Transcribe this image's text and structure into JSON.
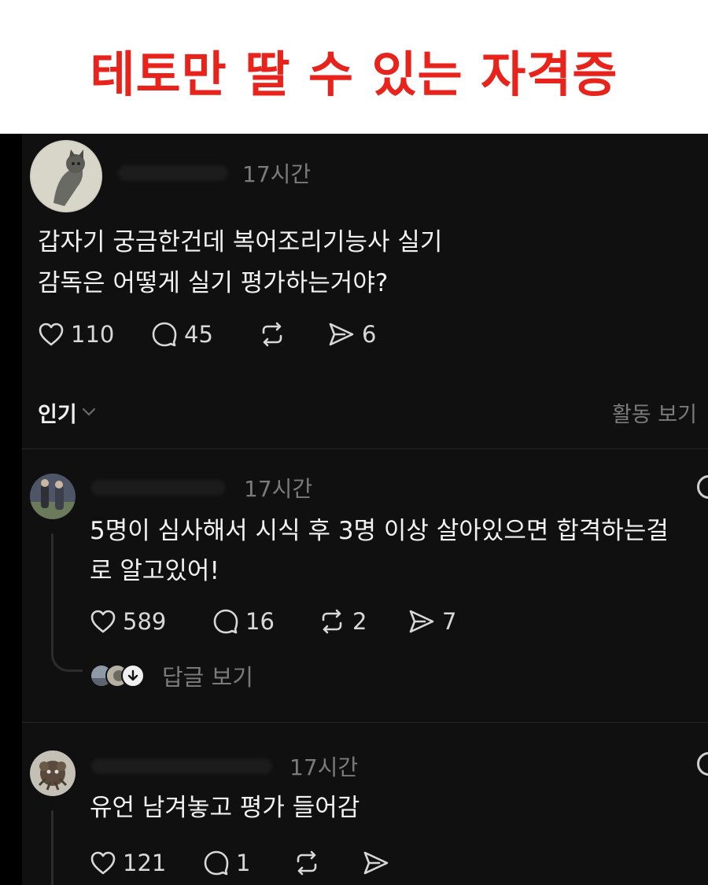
{
  "banner": {
    "title": "테토만 딸 수 있는 자격증",
    "title_color": "#e8231c"
  },
  "post": {
    "timestamp": "17시간",
    "text_line1": "갑자기 궁금한건데 복어조리기능사 실기",
    "text_line2": "감독은 어떻게 실기 평가하는거야?",
    "likes": "110",
    "comments": "45",
    "shares": "6",
    "avatar": "cat-avatar"
  },
  "sort_bar": {
    "label": "인기",
    "activity_link": "활동 보기"
  },
  "replies": [
    {
      "timestamp": "17시간",
      "text_line1": "5명이 심사해서 시식 후 3명 이상 살아있으면 합격하는걸",
      "text_line2": "로 알고있어!",
      "likes": "589",
      "comments": "16",
      "reposts": "2",
      "shares": "7",
      "view_replies_label": "답글 보기"
    },
    {
      "timestamp": "17시간",
      "text_line1": "유언 남겨놓고 평가 들어감",
      "likes": "121",
      "comments": "1"
    }
  ],
  "colors": {
    "background": "#101010",
    "text": "#f2f2f2",
    "muted": "#7b7b7b"
  }
}
